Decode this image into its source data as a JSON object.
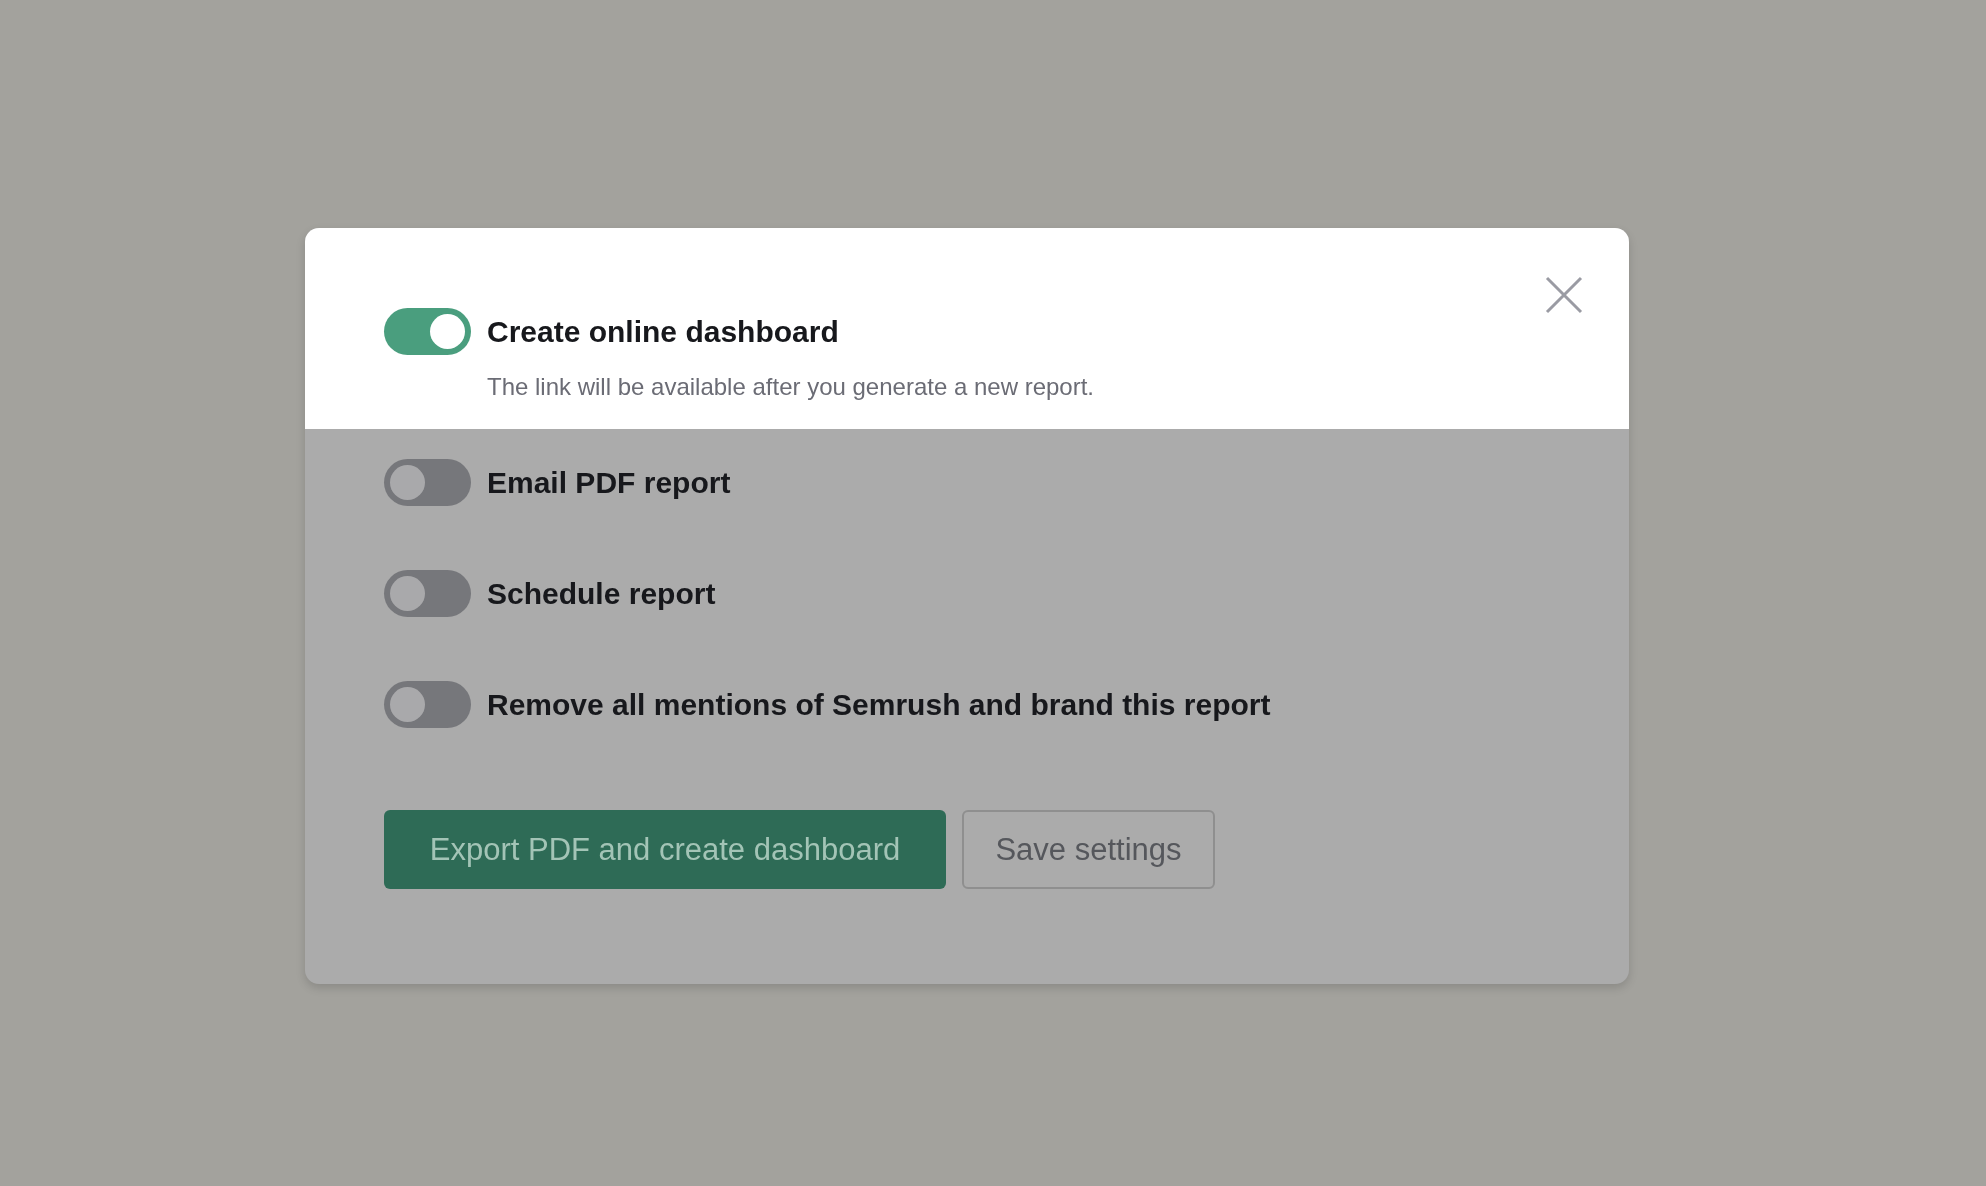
{
  "dialog": {
    "options": [
      {
        "label": "Create online dashboard",
        "on": true,
        "highlighted": true,
        "description": "The link will be available after you generate a new report."
      },
      {
        "label": "Email PDF report",
        "on": false,
        "highlighted": false
      },
      {
        "label": "Schedule report",
        "on": false,
        "highlighted": false
      },
      {
        "label": "Remove all mentions of Semrush and brand this report",
        "on": false,
        "highlighted": false
      }
    ],
    "buttons": [
      {
        "label": "Export PDF and create dashboard",
        "kind": "primary"
      },
      {
        "label": "Save settings",
        "kind": "secondary"
      }
    ]
  }
}
